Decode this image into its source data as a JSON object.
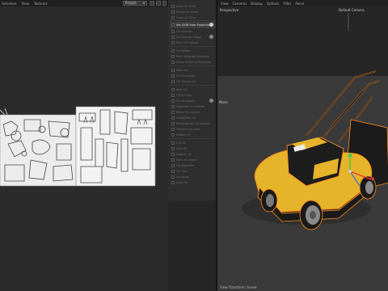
{
  "uv_editor": {
    "menu": [
      "Selection",
      "View",
      "Textures"
    ],
    "snap_dropdown": "Project"
  },
  "uv_menu": {
    "items": [
      {
        "label": "Auto UV Slicer",
        "active": false
      },
      {
        "label": "Rotate to Stripe",
        "active": false
      },
      {
        "label": "Copy UV Slice",
        "active": false
      },
      {
        "label": "Set UVW from Projection",
        "active": true
      },
      {
        "label": "UV Unwrap",
        "active": false
      },
      {
        "label": "UV Unwrap Edges",
        "active": false
      },
      {
        "label": "Pack UV Islands",
        "active": false
      },
      {
        "label": "UV Rotate",
        "active": false
      },
      {
        "label": "Pack Selected Polygons",
        "active": false
      },
      {
        "label": "Stack Selected Polygons",
        "active": false
      },
      {
        "label": "Weld UV",
        "active": false
      },
      {
        "label": "Fix UV Seams",
        "active": false
      },
      {
        "label": "UV Terrain UV",
        "active": false
      },
      {
        "label": "Split UV",
        "active": false
      },
      {
        "label": "Fill UV Gap",
        "active": false
      },
      {
        "label": "UV Navigator",
        "active": false
      },
      {
        "label": "Optimize UV Islands",
        "active": false
      },
      {
        "label": "Relax UV Islands",
        "active": false
      },
      {
        "label": "Straighten UV",
        "active": false
      },
      {
        "label": "Rectangulize UV Islands",
        "active": false
      },
      {
        "label": "Transfer UV Data",
        "active": false
      },
      {
        "label": "Distort UV",
        "active": false
      },
      {
        "label": "Cut UV",
        "active": false
      },
      {
        "label": "Sew UV",
        "active": false
      },
      {
        "label": "Inspect UV",
        "active": false
      },
      {
        "label": "Mark UV Seam",
        "active": false
      },
      {
        "label": "UV Magnifier",
        "active": false
      },
      {
        "label": "UV Grid",
        "active": false
      },
      {
        "label": "UV Seam",
        "active": false
      },
      {
        "label": "Grid Inc",
        "active": false
      }
    ]
  },
  "viewport": {
    "menu": [
      "View",
      "Cameras",
      "Display",
      "Options",
      "Filter",
      "Panel"
    ],
    "view_label": "Perspective",
    "camera_label": "Default Camera",
    "side_label": "Move",
    "footer": "View Transform: Scene"
  },
  "colors": {
    "mower_body": "#e6b42a",
    "mower_dark": "#1a1a1a",
    "selection_outline": "#ff8c1a",
    "axis_y": "#37c94a",
    "axis_x": "#e03a3a",
    "axis_z": "#3a6fe0"
  }
}
